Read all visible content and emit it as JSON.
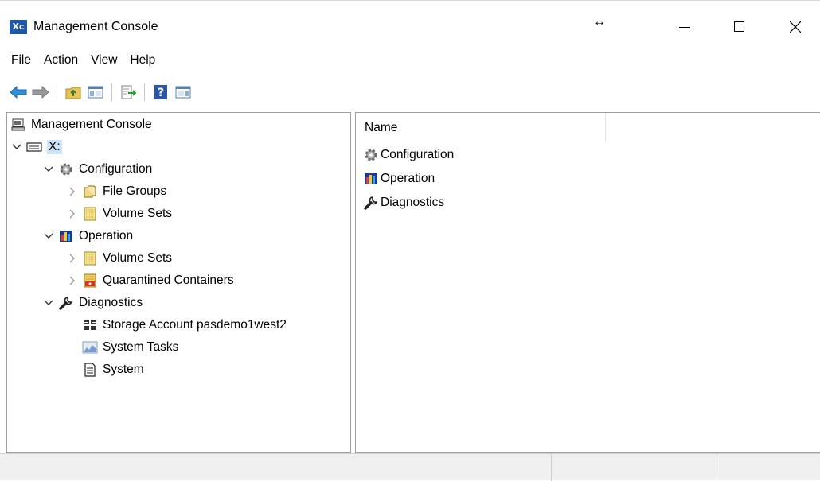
{
  "window": {
    "title": "Management Console",
    "logo_text": "Xc",
    "resize_glyph": "↔"
  },
  "menu": [
    "File",
    "Action",
    "View",
    "Help"
  ],
  "toolbar": {
    "icons": [
      "back-arrow-icon",
      "forward-arrow-icon",
      "up-folder-icon",
      "show-hide-tree-icon",
      "export-list-icon",
      "help-icon",
      "properties-pane-icon"
    ]
  },
  "tree": {
    "root": "Management Console",
    "drive": "X:",
    "configuration": {
      "label": "Configuration",
      "children": [
        "File Groups",
        "Volume Sets"
      ]
    },
    "operation": {
      "label": "Operation",
      "children": [
        "Volume Sets",
        "Quarantined Containers"
      ]
    },
    "diagnostics": {
      "label": "Diagnostics",
      "children": [
        "Storage Account pasdemo1west2",
        "System Tasks",
        "System"
      ]
    }
  },
  "list": {
    "column_name": "Name",
    "items": [
      "Configuration",
      "Operation",
      "Diagnostics"
    ]
  },
  "colors": {
    "selection": "#cce4f7",
    "logo_bg": "#1e58a8"
  }
}
